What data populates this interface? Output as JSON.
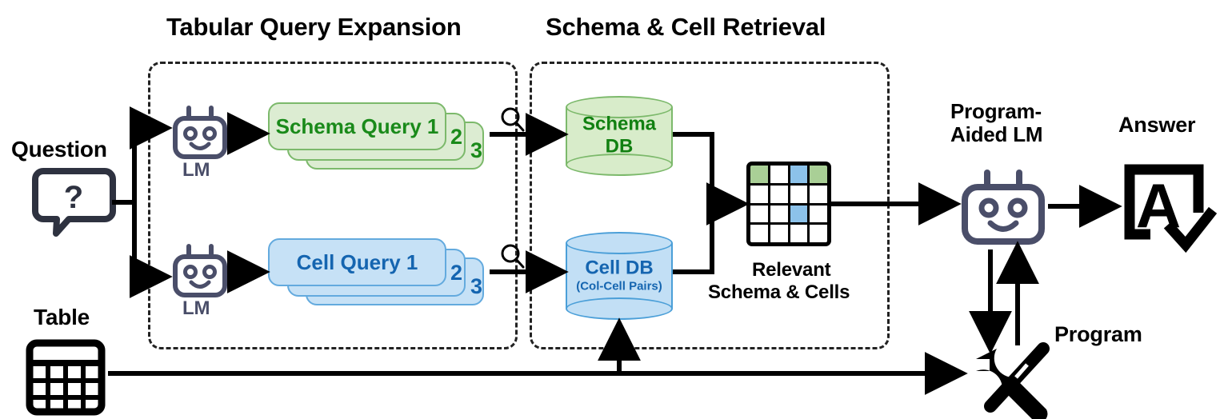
{
  "diagram": {
    "title": "Tabular Query Expansion / Schema & Cell Retrieval pipeline",
    "stages": {
      "tabular_query_expansion": "Tabular Query Expansion",
      "schema_cell_retrieval": "Schema & Cell Retrieval"
    },
    "inputs": {
      "question": "Question",
      "table": "Table"
    },
    "lm_top_label": "LM",
    "lm_bottom_label": "LM",
    "schema_branch": {
      "card_label": "Schema Query 1",
      "stack_numbers": [
        "2",
        "3"
      ],
      "db_title": "Schema",
      "db_subtitle": "DB"
    },
    "cell_branch": {
      "card_label": "Cell Query 1",
      "stack_numbers": [
        "2",
        "3"
      ],
      "db_title": "Cell DB",
      "db_subtitle": "(Col-Cell Pairs)"
    },
    "relevant": {
      "caption_line1": "Relevant",
      "caption_line2": "Schema & Cells",
      "grid": {
        "rows": 4,
        "cols": 4,
        "cells": [
          [
            "green",
            "white",
            "blue",
            "green"
          ],
          [
            "white",
            "white",
            "white",
            "white"
          ],
          [
            "white",
            "white",
            "blue",
            "white"
          ],
          [
            "white",
            "white",
            "white",
            "white"
          ]
        ]
      }
    },
    "output": {
      "pal_label_line1": "Program-",
      "pal_label_line2": "Aided LM",
      "program_label": "Program",
      "answer_label": "Answer",
      "answer_glyph": "A"
    },
    "icons": {
      "question": "question-speech-bubble-icon",
      "table": "table-grid-icon",
      "lm": "robot-icon",
      "search": "magnifier-icon",
      "program": "wrench-screwdriver-icon",
      "answer": "answer-check-box-icon"
    },
    "colors": {
      "green_fill": "#dcecd2",
      "green_stroke": "#7cb96b",
      "green_text": "#1a8a1a",
      "blue_fill": "#c6e1f6",
      "blue_stroke": "#63aade",
      "blue_text": "#1565b0",
      "robot": "#4a4e69",
      "line": "#000000"
    }
  }
}
